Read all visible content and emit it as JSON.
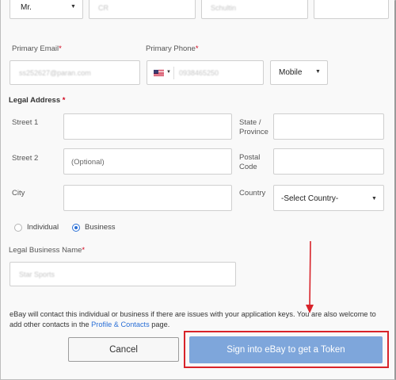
{
  "name_row": {
    "title_value": "Mr.",
    "first_name_value": "CR",
    "last_name_value": "Schultin"
  },
  "contact": {
    "email_label": "Primary Email",
    "email_value": "ss252627@paran.com",
    "phone_label": "Primary Phone",
    "phone_value": "0938465250",
    "phone_type": "Mobile",
    "country_flag": "us-flag-icon"
  },
  "legal_address": {
    "heading": "Legal Address",
    "street1_label": "Street 1",
    "street2_label": "Street 2",
    "street2_placeholder": "(Optional)",
    "city_label": "City",
    "state_label_line1": "State /",
    "state_label_line2": "Province",
    "postal_label_line1": "Postal",
    "postal_label_line2": "Code",
    "country_label": "Country",
    "country_value": "-Select Country-"
  },
  "entity_type": {
    "individual_label": "Individual",
    "business_label": "Business",
    "selected": "Business"
  },
  "business": {
    "label": "Legal Business Name",
    "value": "Star Sports"
  },
  "note": {
    "text_before_link": "eBay will contact this individual or business if there are issues with your application keys. You are also welcome to add other contacts in the ",
    "link_text": "Profile & Contacts",
    "text_after_link": " page."
  },
  "buttons": {
    "cancel": "Cancel",
    "sign_in": "Sign into eBay to get a Token"
  },
  "colors": {
    "accent": "#2a6fd6",
    "primary_button": "#7ea6db",
    "highlight": "#d8232a",
    "required": "#d0021b"
  }
}
